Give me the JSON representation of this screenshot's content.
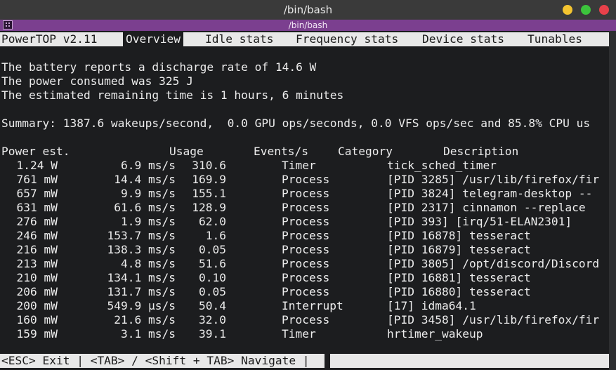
{
  "window": {
    "title": "/bin/bash",
    "tab_title": "/bin/bash",
    "buttons": [
      {
        "name": "minimize",
        "color": "#f4c430"
      },
      {
        "name": "maximize",
        "color": "#3cc43c"
      },
      {
        "name": "close",
        "color": "#e8414a"
      }
    ]
  },
  "menu": {
    "app": "PowerTOP v2.11",
    "tabs": [
      "Overview",
      "Idle stats",
      "Frequency stats",
      "Device stats",
      "Tunables"
    ],
    "active": "Overview"
  },
  "info": {
    "line1": "The battery reports a discharge rate of 14.6 W",
    "line2": "The power consumed was 325 J",
    "line3": "The estimated remaining time is 1 hours, 6 minutes",
    "summary": "Summary: 1387.6 wakeups/second,  0.0 GPU ops/seconds, 0.0 VFS ops/sec and 85.8% CPU us"
  },
  "table": {
    "headers": {
      "power": "Power est.",
      "usage": "Usage",
      "events": "Events/s",
      "category": "Category",
      "description": "Description"
    },
    "rows": [
      {
        "power": "1.24 W",
        "usage": "6.9 ms/s",
        "events": "310.6",
        "category": "Timer",
        "description": "tick_sched_timer"
      },
      {
        "power": "761 mW",
        "usage": "14.4 ms/s",
        "events": "169.9",
        "category": "Process",
        "description": "[PID 3285] /usr/lib/firefox/fir"
      },
      {
        "power": "657 mW",
        "usage": "9.9 ms/s",
        "events": "155.1",
        "category": "Process",
        "description": "[PID 3824] telegram-desktop --"
      },
      {
        "power": "631 mW",
        "usage": "61.6 ms/s",
        "events": "128.9",
        "category": "Process",
        "description": "[PID 2317] cinnamon --replace"
      },
      {
        "power": "276 mW",
        "usage": "1.9 ms/s",
        "events": "62.0",
        "category": "Process",
        "description": "[PID 393] [irq/51-ELAN2301]"
      },
      {
        "power": "246 mW",
        "usage": "153.7 ms/s",
        "events": "1.6",
        "category": "Process",
        "description": "[PID 16878] tesseract"
      },
      {
        "power": "216 mW",
        "usage": "138.3 ms/s",
        "events": "0.05",
        "category": "Process",
        "description": "[PID 16879] tesseract"
      },
      {
        "power": "213 mW",
        "usage": "4.8 ms/s",
        "events": "51.6",
        "category": "Process",
        "description": "[PID 3805] /opt/discord/Discord"
      },
      {
        "power": "210 mW",
        "usage": "134.1 ms/s",
        "events": "0.10",
        "category": "Process",
        "description": "[PID 16881] tesseract"
      },
      {
        "power": "206 mW",
        "usage": "131.7 ms/s",
        "events": "0.05",
        "category": "Process",
        "description": "[PID 16880] tesseract"
      },
      {
        "power": "200 mW",
        "usage": "549.9 μs/s",
        "events": "50.4",
        "category": "Interrupt",
        "description": "[17] idma64.1"
      },
      {
        "power": "160 mW",
        "usage": "21.6 ms/s",
        "events": "32.0",
        "category": "Process",
        "description": "[PID 3458] /usr/lib/firefox/fir"
      },
      {
        "power": "159 mW",
        "usage": "3.1 ms/s",
        "events": "39.1",
        "category": "Timer",
        "description": "hrtimer_wakeup"
      }
    ]
  },
  "footer": {
    "text": "<ESC> Exit | <TAB> / <Shift + TAB> Navigate |"
  }
}
